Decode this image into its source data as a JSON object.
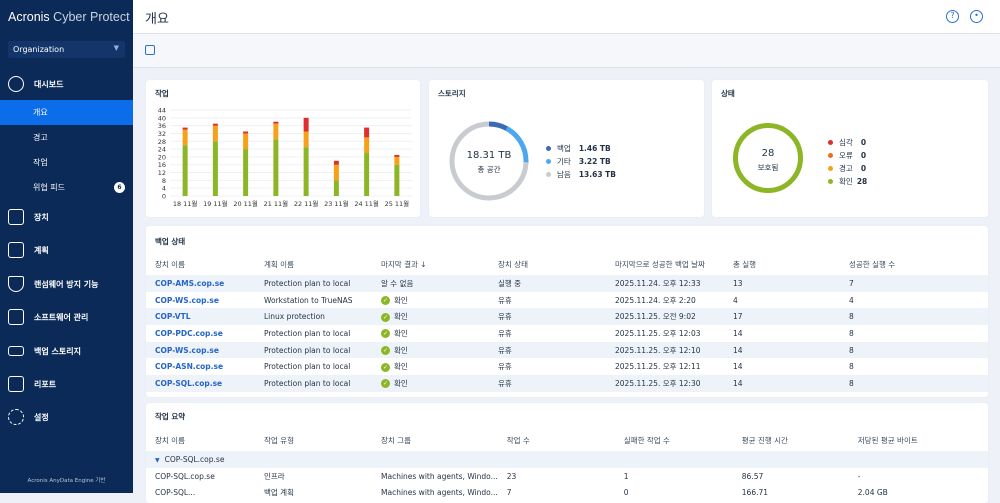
{
  "app": {
    "brand_bold": "Acronis",
    "brand_thin": " Cyber Protect",
    "org": "Organization",
    "footer": "Acronis AnyData Engine 기반"
  },
  "sidebar": {
    "dashboard": "대시보드",
    "subs": [
      "개요",
      "경고",
      "작업",
      "위협 피드"
    ],
    "threat_badge": "6",
    "items": [
      "장치",
      "계획",
      "랜섬웨어 방지 기능",
      "소프트웨어 관리",
      "백업 스토리지",
      "리포트",
      "설정"
    ]
  },
  "header": {
    "title": "개요"
  },
  "colors": {
    "ok": "#8cb625",
    "warning": "#f7a11a",
    "error": "#e02d2d",
    "backup": "#3c6bb3",
    "other": "#4aa8f0",
    "free": "#c8cbd0"
  },
  "chart_data": {
    "type": "bar",
    "title": "작업",
    "stacked": true,
    "categories": [
      "18 11월",
      "19 11월",
      "20 11월",
      "21 11월",
      "22 11월",
      "23 11월",
      "24 11월",
      "25 11월"
    ],
    "yticks": [
      0,
      4,
      8,
      12,
      16,
      20,
      24,
      28,
      32,
      36,
      40,
      44
    ],
    "ylim": [
      0,
      44
    ],
    "series": [
      {
        "name": "ok",
        "color": "#8cb625",
        "values": [
          26,
          28,
          24,
          29,
          25,
          8,
          22,
          16
        ]
      },
      {
        "name": "warning",
        "color": "#f7a11a",
        "values": [
          8,
          8,
          8,
          8,
          8,
          8,
          8,
          4
        ]
      },
      {
        "name": "error",
        "color": "#e02d2d",
        "values": [
          1,
          1,
          1,
          1,
          7,
          2,
          5,
          1
        ]
      }
    ]
  },
  "storage": {
    "title": "스토리지",
    "total": "18.31 TB",
    "total_label": "총 공간",
    "items": [
      {
        "label": "백업",
        "value": "1.46 TB",
        "tb": 1.46
      },
      {
        "label": "기타",
        "value": "3.22 TB",
        "tb": 3.22
      },
      {
        "label": "남음",
        "value": "13.63 TB",
        "tb": 13.63
      }
    ]
  },
  "status": {
    "title": "상태",
    "count": "28",
    "count_label": "보호됨",
    "items": [
      {
        "label": "심각",
        "value": "0"
      },
      {
        "label": "오류",
        "value": "0"
      },
      {
        "label": "경고",
        "value": "0"
      },
      {
        "label": "확인",
        "value": "28"
      }
    ]
  },
  "backup": {
    "title": "백업 상태",
    "columns": [
      "장치 이름",
      "계획 이름",
      "마지막 결과 ↓",
      "장치 상태",
      "마지막으로 성공한 백업 날짜",
      "총 실행",
      "성공한 실행 수"
    ],
    "rows": [
      [
        "COP-AMS.cop.se",
        "Protection plan to local",
        "알 수 없음",
        "실행 중",
        "2025.11.24. 오후 12:33",
        "13",
        "7"
      ],
      [
        "COP-WS.cop.se",
        "Workstation to TrueNAS",
        "확인",
        "유휴",
        "2025.11.24. 오후 2:20",
        "4",
        "4"
      ],
      [
        "COP-VTL",
        "Linux protection",
        "확인",
        "유휴",
        "2025.11.25. 오전 9:02",
        "17",
        "8"
      ],
      [
        "COP-PDC.cop.se",
        "Protection plan to local",
        "확인",
        "유휴",
        "2025.11.25. 오후 12:03",
        "14",
        "8"
      ],
      [
        "COP-WS.cop.se",
        "Protection plan to local",
        "확인",
        "유휴",
        "2025.11.25. 오후 12:10",
        "14",
        "8"
      ],
      [
        "COP-ASN.cop.se",
        "Protection plan to local",
        "확인",
        "유휴",
        "2025.11.25. 오후 12:11",
        "14",
        "8"
      ],
      [
        "COP-SQL.cop.se",
        "Protection plan to local",
        "확인",
        "유휴",
        "2025.11.25. 오후 12:30",
        "14",
        "8"
      ]
    ]
  },
  "summary": {
    "title": "작업 요약",
    "columns": [
      "장치 이름",
      "작업 유형",
      "장치 그룹",
      "작업 수",
      "실패한 작업 수",
      "평균 진행 시간",
      "저당된 평균 바이트"
    ],
    "group": "COP-SQL.cop.se",
    "rows": [
      [
        "COP-SQL.cop.se",
        "인프라",
        "Machines with agents, Windo...",
        "23",
        "1",
        "86.57",
        "-"
      ],
      [
        "COP-SQL...",
        "백업 계획",
        "Machines with agents, Windo...",
        "7",
        "0",
        "166.71",
        "2.04 GB"
      ]
    ]
  }
}
